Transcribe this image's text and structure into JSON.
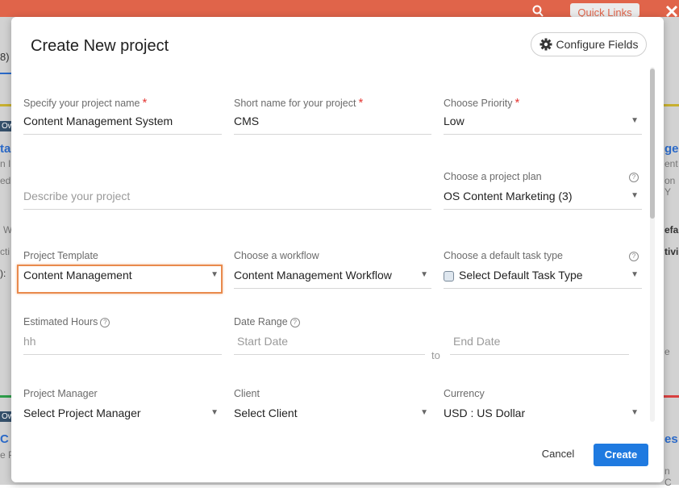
{
  "background": {
    "quick_links_label": "Quick Links",
    "fragments": {
      "count": "8)",
      "tag_left_1": "Ow",
      "tag_left_2": "Ow",
      "left_1": "ta",
      "left_2": "n I",
      "left_3": "ed",
      "left_4": "W",
      "left_5": "cti",
      "left_6": "):",
      "left_7": "C",
      "left_8": "e P",
      "right_1": "ge",
      "right_2": "ent",
      "right_3": "on Y",
      "right_4": "efa",
      "right_5": "tivi",
      "right_6": "e",
      "right_7": "es",
      "right_8": "n C"
    }
  },
  "modal": {
    "title": "Create New project",
    "configure_fields_label": "Configure Fields",
    "fields": {
      "project_name": {
        "label": "Specify your project name",
        "required": "*",
        "value": "Content Management System"
      },
      "short_name": {
        "label": "Short name for your project",
        "required": "*",
        "value": "CMS"
      },
      "priority": {
        "label": "Choose Priority",
        "required": "*",
        "value": "Low"
      },
      "description": {
        "placeholder": "Describe your project"
      },
      "project_plan": {
        "label": "Choose a project plan",
        "value": "OS Content Marketing (3)"
      },
      "template": {
        "label": "Project Template",
        "value": "Content Management"
      },
      "workflow": {
        "label": "Choose a workflow",
        "value": "Content Management Workflow"
      },
      "task_type": {
        "label": "Choose a default task type",
        "value": "Select Default Task Type"
      },
      "estimated_hours": {
        "label": "Estimated Hours",
        "placeholder": "hh"
      },
      "date_range": {
        "label": "Date Range",
        "start_placeholder": "Start Date",
        "to": "to",
        "end_placeholder": "End Date"
      },
      "project_manager": {
        "label": "Project Manager",
        "value": "Select Project Manager"
      },
      "client": {
        "label": "Client",
        "value": "Select Client"
      },
      "currency": {
        "label": "Currency",
        "value": "USD : US Dollar"
      }
    },
    "help_glyph": "?",
    "cancel_label": "Cancel",
    "create_label": "Create"
  },
  "colors": {
    "header": "#e0644a",
    "primary": "#1f7ae0",
    "required": "#e53935",
    "highlight": "#e98a4c"
  }
}
